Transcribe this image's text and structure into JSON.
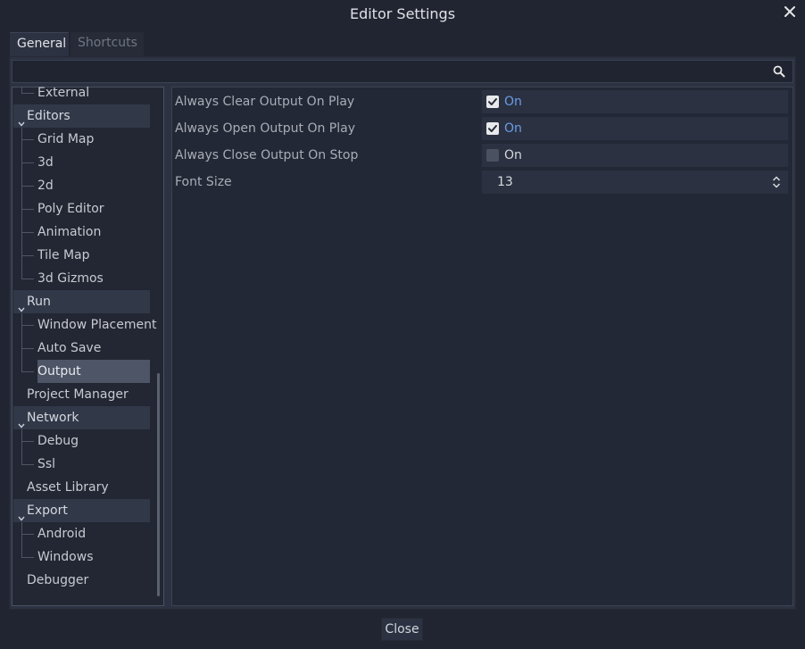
{
  "window": {
    "title": "Editor Settings"
  },
  "tabs": [
    {
      "label": "General",
      "active": true
    },
    {
      "label": "Shortcuts",
      "active": false
    }
  ],
  "search": {
    "value": "",
    "placeholder": ""
  },
  "tree": {
    "items": [
      {
        "label": "External"
      },
      {
        "label": "Editors"
      },
      {
        "label": "Grid Map"
      },
      {
        "label": "3d"
      },
      {
        "label": "2d"
      },
      {
        "label": "Poly Editor"
      },
      {
        "label": "Animation"
      },
      {
        "label": "Tile Map"
      },
      {
        "label": "3d Gizmos"
      },
      {
        "label": "Run"
      },
      {
        "label": "Window Placement"
      },
      {
        "label": "Auto Save"
      },
      {
        "label": "Output"
      },
      {
        "label": "Project Manager"
      },
      {
        "label": "Network"
      },
      {
        "label": "Debug"
      },
      {
        "label": "Ssl"
      },
      {
        "label": "Asset Library"
      },
      {
        "label": "Export"
      },
      {
        "label": "Android"
      },
      {
        "label": "Windows"
      },
      {
        "label": "Debugger"
      }
    ]
  },
  "properties": [
    {
      "label": "Always Clear Output On Play",
      "text": "On",
      "checked": true
    },
    {
      "label": "Always Open Output On Play",
      "text": "On",
      "checked": true
    },
    {
      "label": "Always Close Output On Stop",
      "text": "On",
      "checked": false
    },
    {
      "label": "Font Size",
      "value": "13"
    }
  ],
  "footer": {
    "close_label": "Close"
  },
  "colors": {
    "accent": "#699ce8",
    "background": "#202531",
    "panel": "#2c3241",
    "selection": "#4d5566"
  },
  "icons": {
    "close": "close-icon",
    "search": "search-icon",
    "expand": "chevron-down-icon",
    "spin": "spinbox-arrows-icon"
  }
}
